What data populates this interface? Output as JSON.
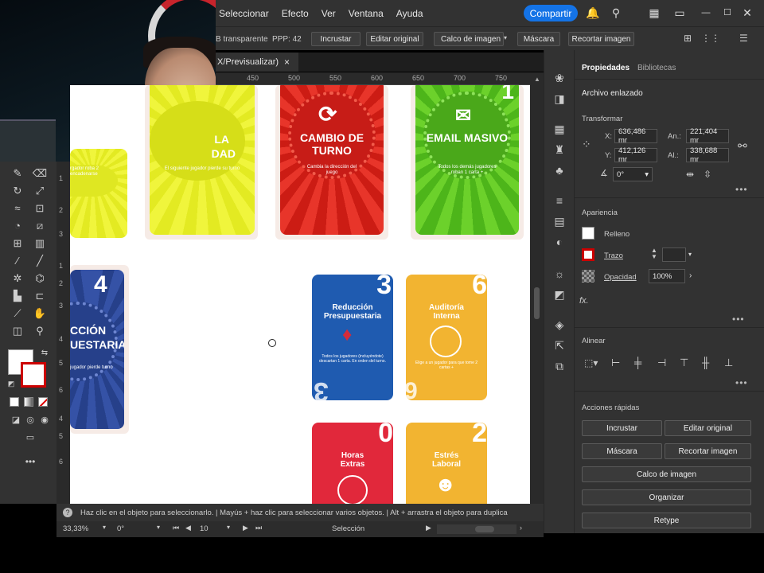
{
  "menu": {
    "items": [
      "Seleccionar",
      "Efecto",
      "Ver",
      "Ventana",
      "Ayuda"
    ],
    "share_label": "Compartir"
  },
  "control_bar": {
    "info": "B transparente",
    "ppp": "PPP: 42",
    "embed": "Incrustar",
    "edit_original": "Editar original",
    "image_trace": "Calco de imagen",
    "mask": "Máscara",
    "crop": "Recortar imagen"
  },
  "document_tab": {
    "label": "X/Previsualizar)",
    "close": "×"
  },
  "ruler": {
    "top": [
      "450",
      "500",
      "550",
      "600",
      "650",
      "700",
      "750"
    ],
    "left": [
      "1",
      "2",
      "3",
      "1",
      "2",
      "3",
      "4",
      "5",
      "6",
      "4",
      "5",
      "6"
    ]
  },
  "canvas_cards": [
    {
      "title1": "LA",
      "title2": "DAD",
      "sub": "El siguiente jugador pierde su turno",
      "color": "#e8ef2a"
    },
    {
      "title1": "CAMBIO DE TURNO",
      "sub": "Cambia la dirección del juego",
      "color": "#e12a1e"
    },
    {
      "title1": "EMAIL MASIVO",
      "sub": "Todos los demás jugadores roban 1 carta +",
      "number": "1",
      "color": "#5bc21f"
    },
    {
      "title1": "4",
      "title2": "CCIÓN",
      "title3": "UESTARIA",
      "sub": "jugador pierde turno",
      "color": "#2d4a9a"
    },
    {
      "title1": "Reducción",
      "title2": "Presupuestaria",
      "sub": "Todos los jugadores (incluyéndote) descartan 1 carta. En orden del turno.",
      "number": "3",
      "corner": "3",
      "color": "#1f5bb0"
    },
    {
      "title1": "Auditoría",
      "title2": "Interna",
      "sub": "Elige a un jugador para que tome 2 cartas +",
      "number": "6",
      "corner": "9",
      "color": "#f2b431"
    },
    {
      "title1": "Horas",
      "title2": "Extras",
      "number": "0",
      "color": "#e1283b"
    },
    {
      "title1": "Estrés",
      "title2": "Laboral",
      "number": "2",
      "color": "#f2b431"
    },
    {
      "sub": "rgador roba 2 encadenarse",
      "color": "#e8ef2a"
    }
  ],
  "props": {
    "tabs": [
      "Propiedades",
      "Bibliotecas"
    ],
    "linked_file": "Archivo enlazado",
    "transform": "Transformar",
    "x_label": "X:",
    "x_value": "636,486 mr",
    "y_label": "Y:",
    "y_value": "412,126 mr",
    "w_label": "An.:",
    "w_value": "221,404 mr",
    "h_label": "Al.:",
    "h_value": "338,688 mr",
    "angle_value": "0°",
    "appearance": "Apariencia",
    "fill": "Relleno",
    "stroke": "Trazo",
    "opacity": "Opacidad",
    "opacity_value": "100%",
    "fx": "fx.",
    "align": "Alinear",
    "quick_actions": "Acciones rápidas",
    "qa_embed": "Incrustar",
    "qa_edit": "Editar original",
    "qa_mask": "Máscara",
    "qa_crop": "Recortar imagen",
    "qa_trace": "Calco de imagen",
    "qa_arrange": "Organizar",
    "qa_retype": "Retype"
  },
  "status": {
    "hint": "Haz clic en el objeto para seleccionarlo.  |  Mayús + haz clic para seleccionar varios objetos.  |  Alt + arrastra el objeto para duplica"
  },
  "bottom": {
    "zoom": "33,33%",
    "rotation": "0°",
    "artboard": "10",
    "mode": "Selección"
  },
  "colors": {
    "accent": "#1473e6",
    "panel": "#323232",
    "dark": "#262626"
  }
}
